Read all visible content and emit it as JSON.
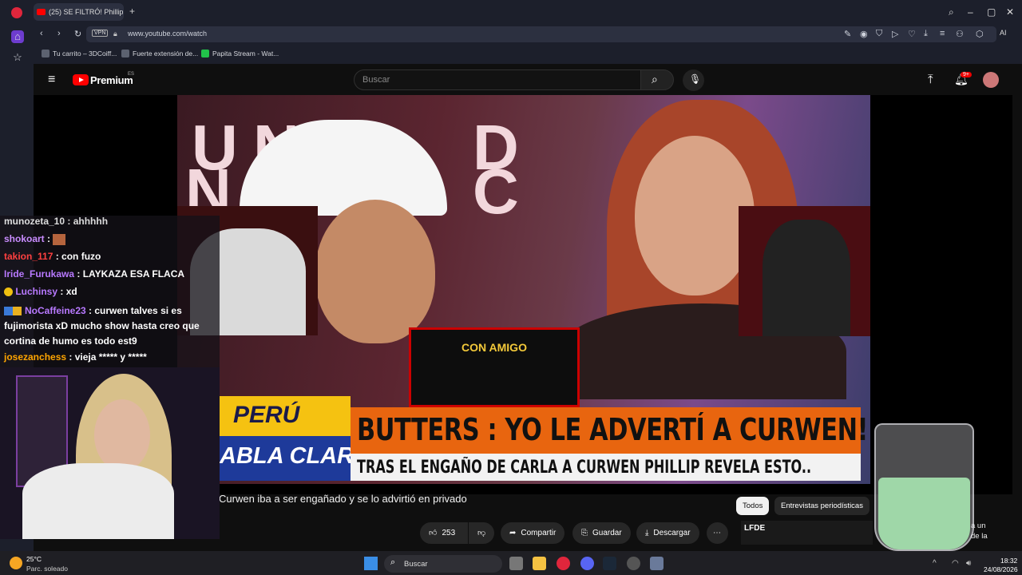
{
  "browser": {
    "tab_title": "(25) SE FILTRÓ! Phillip",
    "url": "www.youtube.com/watch",
    "vpn_label": "VPN",
    "ai_label": "AI",
    "bookmarks": [
      "Tu carrito – 3DCoiff...",
      "Fuerte extensión de...",
      "Papita Stream - Wat..."
    ]
  },
  "youtube": {
    "logo": "Premium",
    "region": "ES",
    "search_placeholder": "Buscar",
    "notif_badge": "9+",
    "video": {
      "bg_text": [
        "U",
        "N",
        "D",
        "N",
        "C"
      ],
      "tag1": "PERÚ",
      "tag2": "ABLA CLARO",
      "headline": "BUTTERS : YO LE ADVERTÍ A CURWEN!",
      "subheadline": "TRAS EL ENGAÑO DE CARLA A CURWEN PHILLIP REVELA ESTO..",
      "con_amigo": "CON AMIGO"
    },
    "title": "Curwen iba a ser engañado y se lo advirtió en privado",
    "chips": [
      "Todos",
      "Entrevistas periodísticas"
    ],
    "actions": {
      "likes": "253",
      "share": "Compartir",
      "save": "Guardar",
      "download": "Descargar"
    },
    "rec_label": "LFDE",
    "rec_text": "a un de la"
  },
  "chat": {
    "messages": [
      {
        "user": "munozeta_10",
        "text": "ahhhhh",
        "color": "#ffffff"
      },
      {
        "user": "shokoart",
        "text": "",
        "color": "#c98cff"
      },
      {
        "user": "takion_117",
        "text": "con fuzo",
        "color": "#ff4040"
      },
      {
        "user": "Iride_Furukawa",
        "text": "LAYKAZA ESA FLACA",
        "color": "#b879ff"
      },
      {
        "user": "Luchinsy",
        "text": "xd",
        "color": "#b879ff"
      },
      {
        "user": "NoCaffeine23",
        "text": "curwen talves si es fujimorista xD mucho show hasta creo que cortina de humo es todo est9",
        "color": "#b879ff"
      },
      {
        "user": "josezanchess",
        "text": "vieja ***** y *****",
        "color": "#ffa500"
      }
    ]
  },
  "taskbar": {
    "weather_temp": "25°C",
    "weather_desc": "Parc. soleado",
    "search": "Buscar",
    "time": "18:32",
    "date": "24/08/2026"
  }
}
